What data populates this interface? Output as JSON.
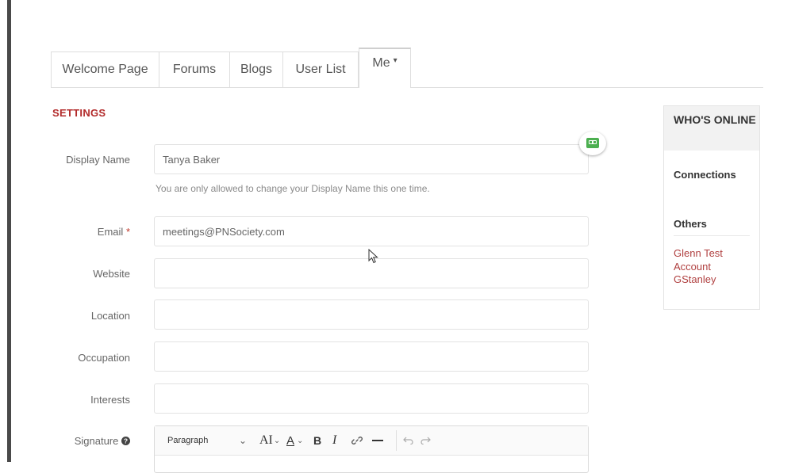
{
  "tabs": [
    {
      "label": "Welcome Page"
    },
    {
      "label": "Forums"
    },
    {
      "label": "Blogs"
    },
    {
      "label": "User List"
    },
    {
      "label": "Me",
      "caret": "▾"
    }
  ],
  "settings": {
    "title": "SETTINGS",
    "display_name": {
      "label": "Display Name",
      "value": "Tanya Baker",
      "hint": "You are only allowed to change your Display Name this one time."
    },
    "email": {
      "label": "Email",
      "required": "*",
      "value": "meetings@PNSociety.com"
    },
    "website": {
      "label": "Website",
      "value": ""
    },
    "location": {
      "label": "Location",
      "value": ""
    },
    "occupation": {
      "label": "Occupation",
      "value": ""
    },
    "interests": {
      "label": "Interests",
      "value": ""
    },
    "signature": {
      "label": "Signature",
      "help_icon": "question-circle-icon"
    }
  },
  "editor": {
    "paragraph": "Paragraph",
    "chevron": "⌄",
    "font_size": "AI",
    "text_color": "A",
    "bold": "B",
    "italic": "I",
    "link_icon": "link-icon",
    "hr_icon": "horizontal-rule-icon",
    "undo_icon": "undo-icon",
    "redo_icon": "redo-icon"
  },
  "sidebar": {
    "title": "WHO'S ONLINE",
    "connections": "Connections",
    "others": "Others",
    "users": [
      "Glenn Test Account",
      "GStanley"
    ]
  },
  "colors": {
    "accent": "#b22a2a",
    "link": "#b04040",
    "chat_icon": "#4caf50"
  }
}
